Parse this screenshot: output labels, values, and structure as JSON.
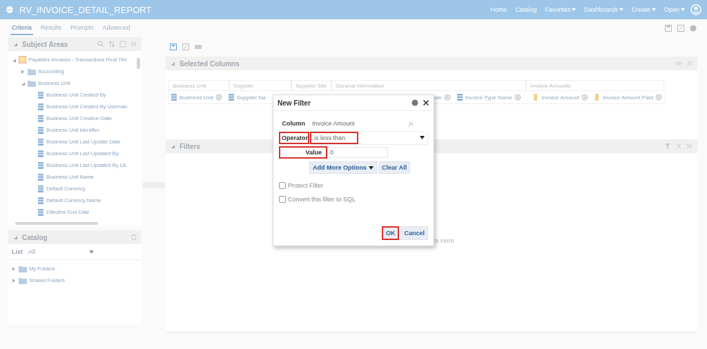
{
  "app_bar": {
    "title": "RV_INVOICE_DETAIL_REPORT",
    "nav": [
      {
        "label": "Home",
        "menu": false
      },
      {
        "label": "Catalog",
        "menu": false
      },
      {
        "label": "Favorites",
        "menu": true
      },
      {
        "label": "Dashboards",
        "menu": true
      },
      {
        "label": "Create",
        "menu": true
      },
      {
        "label": "Open",
        "menu": true
      }
    ]
  },
  "tabs": [
    {
      "label": "Criteria",
      "selected": true
    },
    {
      "label": "Results",
      "selected": false
    },
    {
      "label": "Prompts",
      "selected": false
    },
    {
      "label": "Advanced",
      "selected": false
    }
  ],
  "subject_areas": {
    "title": "Subject Areas",
    "tree": [
      {
        "label": "Payables Invoices - Transactions Real Tim",
        "kind": "subject",
        "expanded": true,
        "children": [
          {
            "label": "Accounting",
            "kind": "folder",
            "expanded": false
          },
          {
            "label": "Business Unit",
            "kind": "folder",
            "expanded": true,
            "children": [
              {
                "label": "Business Unit Created By",
                "kind": "column"
              },
              {
                "label": "Business Unit Created By Usernan",
                "kind": "column"
              },
              {
                "label": "Business Unit Creation Date",
                "kind": "column"
              },
              {
                "label": "Business Unit Identifier",
                "kind": "column"
              },
              {
                "label": "Business Unit Last Update Date",
                "kind": "column"
              },
              {
                "label": "Business Unit Last Updated By",
                "kind": "column"
              },
              {
                "label": "Business Unit Last Updated By Us",
                "kind": "column"
              },
              {
                "label": "Business Unit Name",
                "kind": "column"
              },
              {
                "label": "Default Currency",
                "kind": "column"
              },
              {
                "label": "Default Currency Name",
                "kind": "column"
              },
              {
                "label": "Effective End Date",
                "kind": "column"
              }
            ]
          }
        ]
      }
    ]
  },
  "catalog": {
    "title": "Catalog",
    "list_label": "List",
    "list_value": "All",
    "tree": [
      {
        "label": "My Folders",
        "kind": "folder",
        "expanded": false
      },
      {
        "label": "Shared Folders",
        "kind": "folder",
        "expanded": false
      }
    ]
  },
  "selected_columns": {
    "title": "Selected Columns",
    "groups": [
      "Business Unit",
      "Supplier",
      "Supplier Site",
      "General Information",
      "Invoice Amounts"
    ],
    "chips": [
      {
        "label": "Business Unit",
        "kind": "attribute",
        "icon": true,
        "options_icon": true
      },
      {
        "label": "Supplier Na",
        "kind": "attribute",
        "icon": true,
        "options_icon": false
      },
      {
        "label": "ate",
        "icon": false,
        "options_icon": true
      },
      {
        "label": "Invoice Type Name",
        "kind": "attribute",
        "icon": true,
        "options_icon": true
      },
      {
        "label": "Invoice Amount",
        "kind": "measure",
        "icon": true,
        "options_icon": true
      },
      {
        "label": "Invoice Amount Paid",
        "kind": "measure",
        "icon": true,
        "options_icon": true
      }
    ]
  },
  "filters": {
    "title": "Filters",
    "hint": "rs Here"
  },
  "dialog": {
    "title": "New Filter",
    "column_label": "Column",
    "column_value": "Invoice Amount",
    "formula_symbol": "fx",
    "operator_label": "Operator",
    "operator_value": "is less than",
    "operator_highlighted": true,
    "value_label": "Value",
    "value": "0",
    "value_highlighted": true,
    "add_more": "Add More Options",
    "clear_all": "Clear All",
    "options": [
      {
        "label": "Protect Filter",
        "checked": false
      },
      {
        "label": "Convert this filter to SQL",
        "checked": false
      }
    ],
    "ok": "OK",
    "ok_highlighted": true,
    "cancel": "Cancel"
  }
}
